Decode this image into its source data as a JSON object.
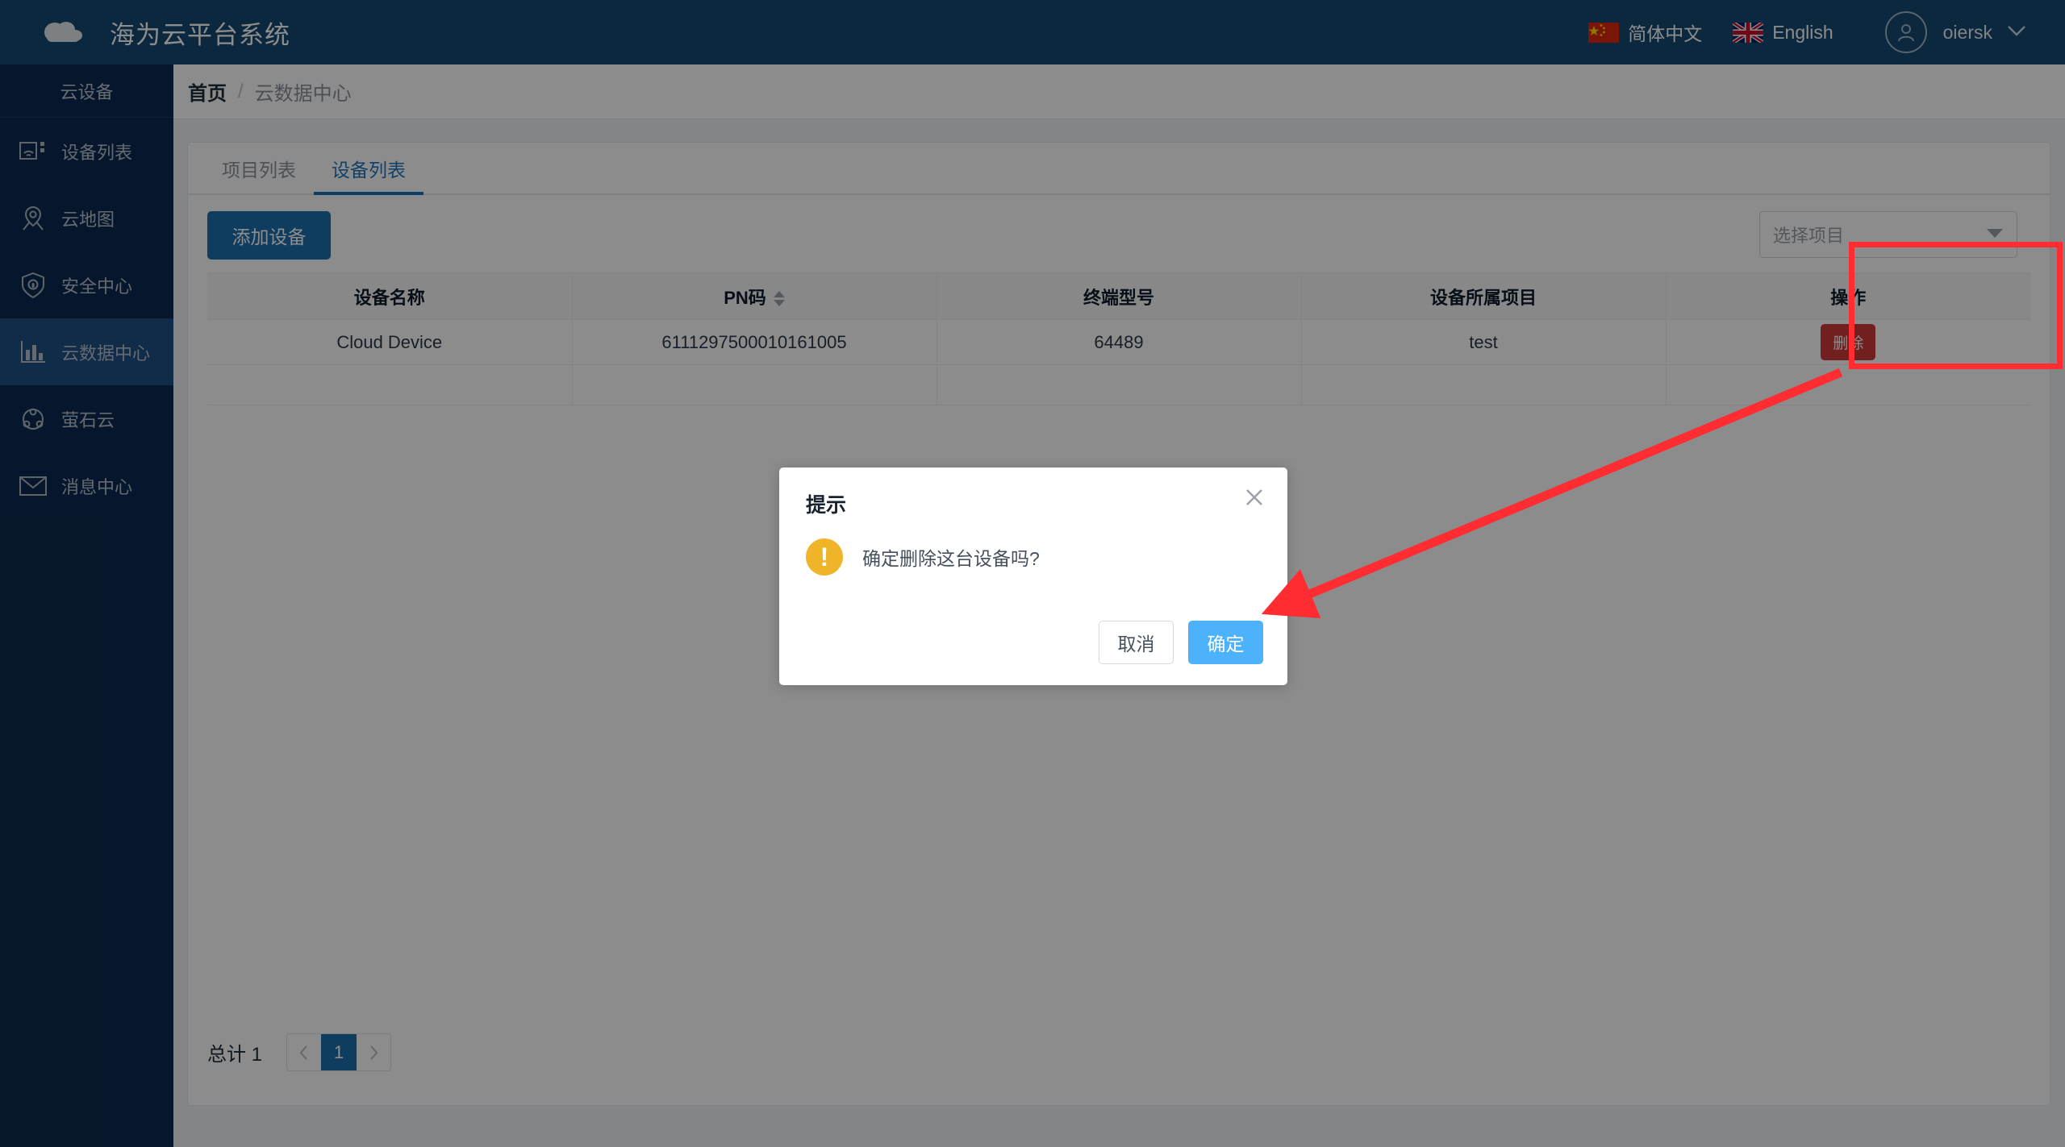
{
  "header": {
    "brand_title": "海为云平台系统",
    "logo_icon": "cloud-icon",
    "languages": [
      {
        "label": "简体中文",
        "flag": "cn-flag-icon"
      },
      {
        "label": "English",
        "flag": "uk-flag-icon"
      }
    ],
    "user": {
      "name": "oiersk",
      "avatar_icon": "user-avatar-icon",
      "caret_icon": "chevron-down-icon"
    }
  },
  "sidebar": {
    "title": "云设备",
    "items": [
      {
        "label": "设备列表",
        "icon": "device-wifi-icon",
        "active": false
      },
      {
        "label": "云地图",
        "icon": "map-pin-icon",
        "active": false
      },
      {
        "label": "安全中心",
        "icon": "shield-lock-icon",
        "active": false
      },
      {
        "label": "云数据中心",
        "icon": "bar-chart-icon",
        "active": true
      },
      {
        "label": "萤石云",
        "icon": "ezviz-icon",
        "active": false
      },
      {
        "label": "消息中心",
        "icon": "envelope-icon",
        "active": false
      }
    ]
  },
  "breadcrumb": {
    "home": "首页",
    "separator": "/",
    "current": "云数据中心"
  },
  "tabs": [
    {
      "label": "项目列表",
      "active": false
    },
    {
      "label": "设备列表",
      "active": true
    }
  ],
  "toolbar": {
    "add_device_label": "添加设备",
    "project_select_placeholder": "选择项目",
    "project_select_value": "",
    "dropdown_icon": "chevron-down-icon"
  },
  "table": {
    "columns": [
      {
        "label": "设备名称",
        "sortable": false
      },
      {
        "label": "PN码",
        "sortable": true
      },
      {
        "label": "终端型号",
        "sortable": false
      },
      {
        "label": "设备所属项目",
        "sortable": false
      },
      {
        "label": "操作",
        "sortable": false
      }
    ],
    "rows": [
      {
        "device_name": "Cloud Device",
        "pn_code": "6111297500010161005",
        "terminal_model": "64489",
        "project": "test",
        "action_label": "删除"
      }
    ]
  },
  "pagination": {
    "total_label": "总计 1",
    "prev_icon": "chevron-left-icon",
    "next_icon": "chevron-right-icon",
    "current_page": "1"
  },
  "modal": {
    "title": "提示",
    "close_icon": "close-icon",
    "warning_icon": "exclamation-icon",
    "warning_glyph": "!",
    "message": "确定删除这台设备吗?",
    "cancel_label": "取消",
    "confirm_label": "确定"
  },
  "annotations": {
    "highlight_color": "#ff2d32",
    "arrow_color": "#ff2d32"
  }
}
